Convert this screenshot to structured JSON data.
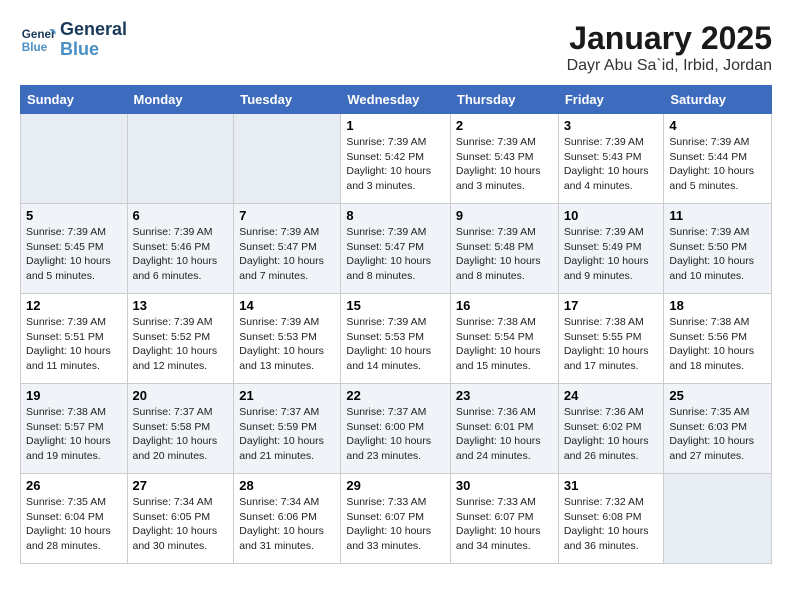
{
  "header": {
    "logo_line1": "General",
    "logo_line2": "Blue",
    "month": "January 2025",
    "location": "Dayr Abu Sa`id, Irbid, Jordan"
  },
  "weekdays": [
    "Sunday",
    "Monday",
    "Tuesday",
    "Wednesday",
    "Thursday",
    "Friday",
    "Saturday"
  ],
  "weeks": [
    [
      {
        "day": "",
        "text": ""
      },
      {
        "day": "",
        "text": ""
      },
      {
        "day": "",
        "text": ""
      },
      {
        "day": "1",
        "text": "Sunrise: 7:39 AM\nSunset: 5:42 PM\nDaylight: 10 hours and 3 minutes."
      },
      {
        "day": "2",
        "text": "Sunrise: 7:39 AM\nSunset: 5:43 PM\nDaylight: 10 hours and 3 minutes."
      },
      {
        "day": "3",
        "text": "Sunrise: 7:39 AM\nSunset: 5:43 PM\nDaylight: 10 hours and 4 minutes."
      },
      {
        "day": "4",
        "text": "Sunrise: 7:39 AM\nSunset: 5:44 PM\nDaylight: 10 hours and 5 minutes."
      }
    ],
    [
      {
        "day": "5",
        "text": "Sunrise: 7:39 AM\nSunset: 5:45 PM\nDaylight: 10 hours and 5 minutes."
      },
      {
        "day": "6",
        "text": "Sunrise: 7:39 AM\nSunset: 5:46 PM\nDaylight: 10 hours and 6 minutes."
      },
      {
        "day": "7",
        "text": "Sunrise: 7:39 AM\nSunset: 5:47 PM\nDaylight: 10 hours and 7 minutes."
      },
      {
        "day": "8",
        "text": "Sunrise: 7:39 AM\nSunset: 5:47 PM\nDaylight: 10 hours and 8 minutes."
      },
      {
        "day": "9",
        "text": "Sunrise: 7:39 AM\nSunset: 5:48 PM\nDaylight: 10 hours and 8 minutes."
      },
      {
        "day": "10",
        "text": "Sunrise: 7:39 AM\nSunset: 5:49 PM\nDaylight: 10 hours and 9 minutes."
      },
      {
        "day": "11",
        "text": "Sunrise: 7:39 AM\nSunset: 5:50 PM\nDaylight: 10 hours and 10 minutes."
      }
    ],
    [
      {
        "day": "12",
        "text": "Sunrise: 7:39 AM\nSunset: 5:51 PM\nDaylight: 10 hours and 11 minutes."
      },
      {
        "day": "13",
        "text": "Sunrise: 7:39 AM\nSunset: 5:52 PM\nDaylight: 10 hours and 12 minutes."
      },
      {
        "day": "14",
        "text": "Sunrise: 7:39 AM\nSunset: 5:53 PM\nDaylight: 10 hours and 13 minutes."
      },
      {
        "day": "15",
        "text": "Sunrise: 7:39 AM\nSunset: 5:53 PM\nDaylight: 10 hours and 14 minutes."
      },
      {
        "day": "16",
        "text": "Sunrise: 7:38 AM\nSunset: 5:54 PM\nDaylight: 10 hours and 15 minutes."
      },
      {
        "day": "17",
        "text": "Sunrise: 7:38 AM\nSunset: 5:55 PM\nDaylight: 10 hours and 17 minutes."
      },
      {
        "day": "18",
        "text": "Sunrise: 7:38 AM\nSunset: 5:56 PM\nDaylight: 10 hours and 18 minutes."
      }
    ],
    [
      {
        "day": "19",
        "text": "Sunrise: 7:38 AM\nSunset: 5:57 PM\nDaylight: 10 hours and 19 minutes."
      },
      {
        "day": "20",
        "text": "Sunrise: 7:37 AM\nSunset: 5:58 PM\nDaylight: 10 hours and 20 minutes."
      },
      {
        "day": "21",
        "text": "Sunrise: 7:37 AM\nSunset: 5:59 PM\nDaylight: 10 hours and 21 minutes."
      },
      {
        "day": "22",
        "text": "Sunrise: 7:37 AM\nSunset: 6:00 PM\nDaylight: 10 hours and 23 minutes."
      },
      {
        "day": "23",
        "text": "Sunrise: 7:36 AM\nSunset: 6:01 PM\nDaylight: 10 hours and 24 minutes."
      },
      {
        "day": "24",
        "text": "Sunrise: 7:36 AM\nSunset: 6:02 PM\nDaylight: 10 hours and 26 minutes."
      },
      {
        "day": "25",
        "text": "Sunrise: 7:35 AM\nSunset: 6:03 PM\nDaylight: 10 hours and 27 minutes."
      }
    ],
    [
      {
        "day": "26",
        "text": "Sunrise: 7:35 AM\nSunset: 6:04 PM\nDaylight: 10 hours and 28 minutes."
      },
      {
        "day": "27",
        "text": "Sunrise: 7:34 AM\nSunset: 6:05 PM\nDaylight: 10 hours and 30 minutes."
      },
      {
        "day": "28",
        "text": "Sunrise: 7:34 AM\nSunset: 6:06 PM\nDaylight: 10 hours and 31 minutes."
      },
      {
        "day": "29",
        "text": "Sunrise: 7:33 AM\nSunset: 6:07 PM\nDaylight: 10 hours and 33 minutes."
      },
      {
        "day": "30",
        "text": "Sunrise: 7:33 AM\nSunset: 6:07 PM\nDaylight: 10 hours and 34 minutes."
      },
      {
        "day": "31",
        "text": "Sunrise: 7:32 AM\nSunset: 6:08 PM\nDaylight: 10 hours and 36 minutes."
      },
      {
        "day": "",
        "text": ""
      }
    ]
  ]
}
